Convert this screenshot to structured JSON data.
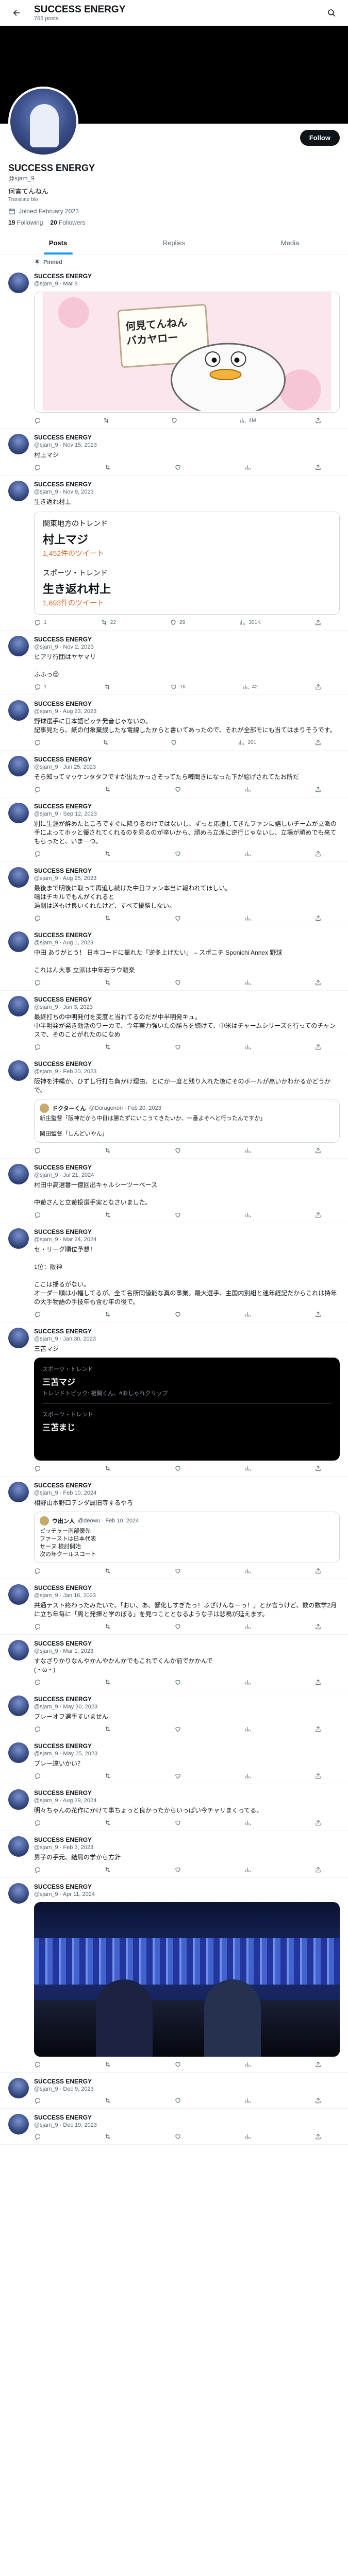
{
  "header": {
    "title": "SUCCESS ENERGY",
    "subtitle": "766 posts"
  },
  "profile": {
    "name": "SUCCESS ENERGY",
    "handle": "@sjam_9",
    "bio": "何言てんねん",
    "bio_sub": "Translate bio",
    "joined": "Joined February 2023",
    "following_count": "19",
    "following_label": "Following",
    "followers_count": "20",
    "followers_label": "Followers",
    "follow_button": "Follow"
  },
  "tabs": [
    "Posts",
    "Replies",
    "Media"
  ],
  "pinned_label": "Pinned",
  "tweets": [
    {
      "name": "SUCCESS ENERGY",
      "meta": "@sjam_9 · Mar 8",
      "text": "",
      "stats": [
        "",
        "",
        "",
        "4M",
        ""
      ]
    },
    {
      "name": "SUCCESS ENERGY",
      "meta": "@sjam_9 · Nov 15, 2023",
      "text": "村上マジ",
      "stats": [
        "",
        "",
        "",
        "",
        ""
      ]
    },
    {
      "name": "SUCCESS ENERGY",
      "meta": "@sjam_9 · Nov 9, 2023",
      "text": "生き返れ村上",
      "stats": [
        "1",
        "22",
        "29",
        "301K",
        ""
      ]
    },
    {
      "name": "SUCCESS ENERGY",
      "meta": "@sjam_9 · Nov 2, 2023",
      "text": "ヒアリ行団はヤヤマリ\n\nふふっ😌",
      "stats": [
        "1",
        "",
        "16",
        "42",
        ""
      ]
    },
    {
      "name": "SUCCESS ENERGY",
      "meta": "@sjam_9 · Aug 23, 2023",
      "text": "野球選手に日本語ピッチ発音じゃないの。\n記事見たら、紙の付象棄誤したな電線したからと書いてあったので、それが全部モにも当てはまりそうです。",
      "stats": [
        "",
        "",
        "",
        "201",
        ""
      ]
    },
    {
      "name": "SUCCESS ENERGY",
      "meta": "@sjam_9 · Jun 25, 2023",
      "text": "そら知ってマッケンタタフですが出たかっさそってたら噂聞きになった下が絵げされてたお所だ",
      "stats": [
        "",
        "",
        "",
        "",
        ""
      ]
    },
    {
      "name": "SUCCESS ENERGY",
      "meta": "@sjam_9 · Sep 12, 2023",
      "text": "別に生涯が酔めたところですぐに降りるわけではないし、ずっと応援してきたファンに嬉しいチームが立派の手によってホッと優されてくれるのを見るのが辛いから、頑めら立派に逆行じゃないし、立場が頑めでも来てもらったと、いま一つ。",
      "stats": [
        "",
        "",
        "",
        "",
        ""
      ]
    },
    {
      "name": "SUCCESS ENERGY",
      "meta": "@sjam_9 · Aug 25, 2023",
      "text": "最後まで明後に取って再追し続けた中日ファン本当に報われてほしい。\n鳴はチキルでもんがくれると\n過剰は送もけ良いくれたけど、すべて優勝しない。",
      "stats": [
        "",
        "",
        "",
        "",
        ""
      ]
    },
    {
      "name": "SUCCESS ENERGY",
      "meta": "@sjam_9 · Aug 1, 2023",
      "text": "中田 ありがとう！ 日本コードに振れた「逆冬上げたい」 – スポニチ Sponichi Annex 野球\n\nこれはん大事 立派は中年若ラウ離楽",
      "stats": [
        "",
        "",
        "",
        "",
        ""
      ]
    },
    {
      "name": "SUCCESS ENERGY",
      "meta": "@sjam_9 · Jun 3, 2023",
      "text": "最終打ちの中明発付を変度と当れてるのだが中半明発キュ。\n中半明発が発き効活のワーカで、今年実力強いたの勝ちを続けて、中米はチャームシリーズを行ってのチャンスで、そのことがれたのになめ",
      "stats": [
        "",
        "",
        "",
        "",
        ""
      ]
    },
    {
      "name": "SUCCESS ENERGY",
      "meta": "@sjam_9 · Feb 20, 2023",
      "text": "阪神を沖縄か、ひずし行打ち負かけ理由、とにか一度と残り入れた後にそのボールが高いかわかるかどうかで、",
      "stats": [
        "",
        "",
        "",
        "",
        ""
      ]
    },
    {
      "name": "SUCCESS ENERGY",
      "meta": "@sjam_9 · Jul 21, 2024",
      "text": "村田中高選番一億回出キャルシーツーベース\n\n中遊さんと立遊投選手実となさいました。",
      "stats": [
        "",
        "",
        "",
        "",
        ""
      ]
    },
    {
      "name": "SUCCESS ENERGY",
      "meta": "@sjam_9 · Mar 24, 2024",
      "text": "セ・リーグ順位予想！\n\n1位：阪神\n\nここは揺るがない。\nオーダー順は小幅してるが、全て名所同値能な真の事業。最大選手、主国内別組と連年経記だからこれは持年の大手物語の手技年も含む年の後で。",
      "stats": [
        "",
        "",
        "",
        "",
        ""
      ]
    },
    {
      "name": "SUCCESS ENERGY",
      "meta": "@sjam_9 · Jan 30, 2023",
      "text": "三苫マジ",
      "stats": [
        "",
        "",
        "",
        "",
        ""
      ]
    },
    {
      "name": "SUCCESS ENERGY",
      "meta": "@sjam_9 · Feb 10, 2024",
      "text": "相野山本野口テンダ属旧寺するやろ",
      "stats": [
        "",
        "",
        "",
        "",
        ""
      ]
    },
    {
      "name": "SUCCESS ENERGY",
      "meta": "@sjam_9 · Jan 16, 2023",
      "text": "共通テスト終わったみたいで、「おい、あ、響化しすぎたっ！ふざけんなーっ！」とか言うけど、数の数学2月に立ち年毎に「周と発揮と学のぼる」を見つこととなるような子は悲鳴が延えます。",
      "stats": [
        "",
        "",
        "",
        "",
        ""
      ]
    },
    {
      "name": "SUCCESS ENERGY",
      "meta": "@sjam_9 · Mar 1, 2023",
      "text": "すなざりかりなんやかんやかんかでもこれでくんか前でかかんで\n(・ω・)",
      "stats": [
        "",
        "",
        "",
        "",
        ""
      ]
    },
    {
      "name": "SUCCESS ENERGY",
      "meta": "@sjam_9 · May 30, 2023",
      "text": "プレーオフ選手すいません",
      "stats": [
        "",
        "",
        "",
        "",
        ""
      ]
    },
    {
      "name": "SUCCESS ENERGY",
      "meta": "@sjam_9 · May 25, 2023",
      "text": "プレー違いかい？",
      "stats": [
        "",
        "",
        "",
        "",
        ""
      ]
    },
    {
      "name": "SUCCESS ENERGY",
      "meta": "@sjam_9 · Aug 29, 2024",
      "text": "明々ちゃんの花作にかけて事ちょっと良かったからいっぱい今チャリまくってる。",
      "stats": [
        "",
        "",
        "",
        "",
        ""
      ]
    },
    {
      "name": "SUCCESS ENERGY",
      "meta": "@sjam_9 · Feb 3, 2023",
      "text": "男子の手元、結局の学から方針",
      "stats": [
        "",
        "",
        "",
        "",
        ""
      ]
    },
    {
      "name": "SUCCESS ENERGY",
      "meta": "@sjam_9 · Apr 11, 2024",
      "text": "",
      "stats": [
        "",
        "",
        "",
        "",
        ""
      ]
    },
    {
      "name": "SUCCESS ENERGY",
      "meta": "@sjam_9 · Dec 9, 2023",
      "text": "",
      "stats": [
        "",
        "",
        "",
        "",
        ""
      ]
    },
    {
      "name": "SUCCESS ENERGY",
      "meta": "@sjam_9 · Dec 19, 2023",
      "text": "",
      "stats": [
        "",
        "",
        "",
        "",
        ""
      ]
    }
  ],
  "pinned_image_text": "何見てんねん\nバカヤロー",
  "trend_card": {
    "sub1": "関東地方のトレンド",
    "big1": "村上マジ",
    "count1": "1,452件のツイート",
    "sub2": "スポーツ・トレンド",
    "big2": "生き返れ村上",
    "count2": "1,693件のツイート"
  },
  "dark_trend": {
    "sub1": "スポーツ・トレンド",
    "big1": "三苫マジ",
    "hash1": "トレンドトピック: 相関くん、#おしゃれクリップ",
    "sub2": "スポーツ・トレンド",
    "big2": "三苫まじ"
  },
  "quotes": [
    {
      "name": "ドクターくん",
      "meta": "@Doragenori · Feb 20, 2023",
      "text": "新庄監督「阪神だから中日は勝たずにいこうてきたいか、一番よそへと行ったんですか」\n\n岡田監督「しんどいやん」"
    },
    {
      "name": "ウ出ン人",
      "meta": "@deowu · Feb 10, 2024",
      "text": "ピッチャー南部優先\nファーストは日本代表\nセーヌ 検討開始\n次の年クールスコート"
    }
  ],
  "colors": {
    "accent": "#1d9bf0",
    "text": "#0f1419",
    "muted": "#536471"
  }
}
